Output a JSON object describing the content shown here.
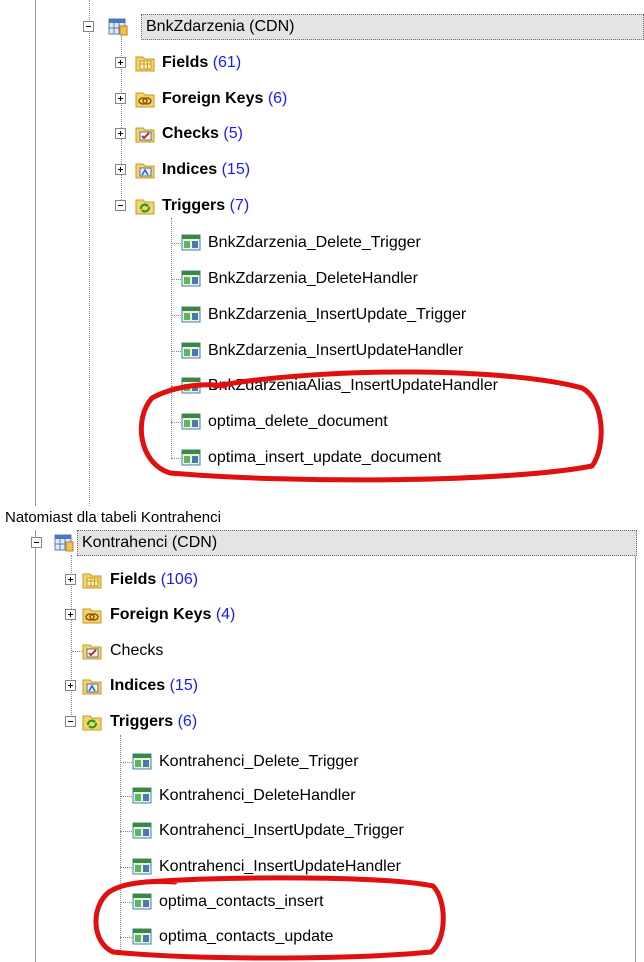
{
  "caption": "Natomiast dla tabeli Kontrahenci",
  "colors": {
    "annotation": "#e01010",
    "count_link": "#1a1aff",
    "header_bg": "#e4e4e4"
  },
  "tree1": {
    "table": "BnkZdarzenia (CDN)",
    "groups": {
      "fields": {
        "label": "Fields",
        "count": "(61)"
      },
      "foreign": {
        "label": "Foreign Keys",
        "count": "(6)"
      },
      "checks": {
        "label": "Checks",
        "count": "(5)"
      },
      "indices": {
        "label": "Indices",
        "count": "(15)"
      },
      "triggers": {
        "label": "Triggers",
        "count": "(7)"
      }
    },
    "triggers": [
      "BnkZdarzenia_Delete_Trigger",
      "BnkZdarzenia_DeleteHandler",
      "BnkZdarzenia_InsertUpdate_Trigger",
      "BnkZdarzenia_InsertUpdateHandler",
      "BnkZdarzeniaAlias_InsertUpdateHandler",
      "optima_delete_document",
      "optima_insert_update_document"
    ]
  },
  "tree2": {
    "table": "Kontrahenci (CDN)",
    "groups": {
      "fields": {
        "label": "Fields",
        "count": "(106)"
      },
      "foreign": {
        "label": "Foreign Keys",
        "count": "(4)"
      },
      "checks": {
        "label": "Checks",
        "count": ""
      },
      "indices": {
        "label": "Indices",
        "count": "(15)"
      },
      "triggers": {
        "label": "Triggers",
        "count": "(6)"
      }
    },
    "triggers": [
      "Kontrahenci_Delete_Trigger",
      "Kontrahenci_DeleteHandler",
      "Kontrahenci_InsertUpdate_Trigger",
      "Kontrahenci_InsertUpdateHandler",
      "optima_contacts_insert",
      "optima_contacts_update"
    ]
  },
  "icons": {
    "table": "table-icon",
    "fields": "fields-icon",
    "foreign": "foreign-key-icon",
    "checks": "checks-icon",
    "indices": "indices-icon",
    "triggers": "triggers-folder-icon",
    "trigger": "trigger-icon"
  }
}
